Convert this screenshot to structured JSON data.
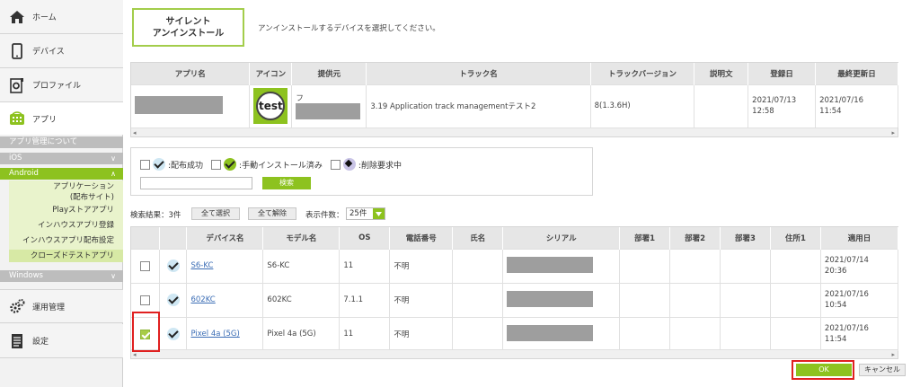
{
  "sidebar": {
    "home": "ホーム",
    "device": "デバイス",
    "profile": "プロファイル",
    "app": "アプリ",
    "app_about": "アプリ管理について",
    "ios": "iOS",
    "android": "Android",
    "android_items": [
      "アプリケーション",
      "(配布サイト)",
      "Playストアアプリ",
      "インハウスアプリ登録",
      "インハウスアプリ配布設定",
      "クローズドテストアプリ"
    ],
    "windows": "Windows",
    "ops": "運用管理",
    "settings": "設定",
    "chevron": "∨",
    "chevron_up": "∧"
  },
  "header": {
    "title_line1": "サイレント",
    "title_line2": "アンインストール",
    "description": "アンインストールするデバイスを選択してください。"
  },
  "app_table": {
    "columns": [
      "アプリ名",
      "アイコン",
      "提供元",
      "トラック名",
      "トラックバージョン",
      "説明文",
      "登録日",
      "最終更新日"
    ],
    "row": {
      "icon_text": "test",
      "provider_prefix": "フ",
      "track_name": "3.19 Application track managementテスト2",
      "track_version": "8(1.3.6H)",
      "registered": [
        "2021/07/13",
        "12:58"
      ],
      "updated": [
        "2021/07/16",
        "11:54"
      ]
    }
  },
  "filter": {
    "delivered": ":配布成功",
    "manual_installed": ":手動インストール済み",
    "delete_requested": ":削除要求中",
    "search_button": "検索"
  },
  "toolbar": {
    "result_label": "検索結果：3件",
    "select_all": "全て選択",
    "deselect_all": "全て解除",
    "per_page_label": "表示件数：",
    "per_page_value": "25件"
  },
  "device_table": {
    "columns": [
      "デバイス名",
      "モデル名",
      "OS",
      "電話番号",
      "氏名",
      "シリアル",
      "部署1",
      "部署2",
      "部署3",
      "住所1",
      "適用日"
    ],
    "rows": [
      {
        "device": "S6-KC",
        "model": "S6-KC",
        "os": "11",
        "phone": "不明",
        "date": [
          "2021/07/14",
          "20:36"
        ]
      },
      {
        "device": "602KC",
        "model": "602KC",
        "os": "7.1.1",
        "phone": "不明",
        "date": [
          "2021/07/16",
          "10:54"
        ]
      },
      {
        "device": "Pixel 4a (5G)",
        "model": "Pixel 4a (5G)",
        "os": "11",
        "phone": "不明",
        "date": [
          "2021/07/16",
          "11:54"
        ]
      }
    ]
  },
  "footer": {
    "ok": "OK",
    "cancel": "キャンセル"
  },
  "scroll": {
    "left": "◂",
    "right": "▸"
  }
}
